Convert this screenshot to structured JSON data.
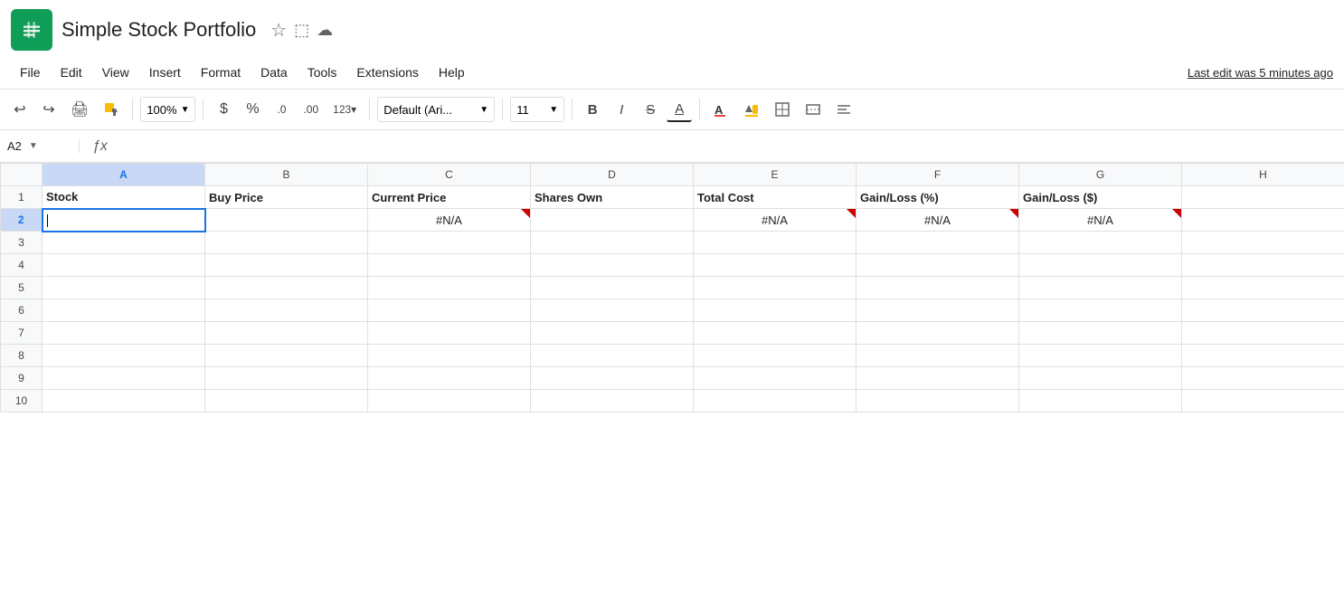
{
  "app": {
    "icon_color": "#0F9D58",
    "title": "Simple Stock Portfolio",
    "icons": [
      "☆",
      "⬚",
      "☁"
    ]
  },
  "menu": {
    "items": [
      "File",
      "Edit",
      "View",
      "Insert",
      "Format",
      "Data",
      "Tools",
      "Extensions",
      "Help"
    ],
    "last_edit": "Last edit was 5 minutes ago"
  },
  "toolbar": {
    "zoom": "100%",
    "currency": "$",
    "percent": "%",
    "decimal_less": ".0",
    "decimal_more": ".00",
    "format_number": "123",
    "font": "Default (Ari...",
    "font_size": "11",
    "bold": "B",
    "italic": "I",
    "strikethrough": "S",
    "underline": "A"
  },
  "formula_bar": {
    "cell_ref": "A2",
    "formula_content": ""
  },
  "spreadsheet": {
    "col_headers": [
      "",
      "A",
      "B",
      "C",
      "D",
      "E",
      "F",
      "G",
      "H"
    ],
    "row_count": 10,
    "headers_row": {
      "stock": "Stock",
      "buy_price": "Buy Price",
      "current_price": "Current Price",
      "shares_own": "Shares Own",
      "total_cost": "Total Cost",
      "gain_loss_pct": "Gain/Loss (%)",
      "gain_loss_dollar": "Gain/Loss ($)"
    },
    "data_rows": [
      {
        "row": 2,
        "a": "",
        "b": "",
        "c": "#N/A",
        "d": "",
        "e": "#N/A",
        "f": "#N/A",
        "g": "#N/A",
        "selected_a": true
      },
      {
        "row": 3,
        "a": "",
        "b": "",
        "c": "",
        "d": "",
        "e": "",
        "f": "",
        "g": ""
      },
      {
        "row": 4,
        "a": "",
        "b": "",
        "c": "",
        "d": "",
        "e": "",
        "f": "",
        "g": ""
      },
      {
        "row": 5,
        "a": "",
        "b": "",
        "c": "",
        "d": "",
        "e": "",
        "f": "",
        "g": ""
      },
      {
        "row": 6,
        "a": "",
        "b": "",
        "c": "",
        "d": "",
        "e": "",
        "f": "",
        "g": ""
      },
      {
        "row": 7,
        "a": "",
        "b": "",
        "c": "",
        "d": "",
        "e": "",
        "f": "",
        "g": ""
      },
      {
        "row": 8,
        "a": "",
        "b": "",
        "c": "",
        "d": "",
        "e": "",
        "f": "",
        "g": ""
      },
      {
        "row": 9,
        "a": "",
        "b": "",
        "c": "",
        "d": "",
        "e": "",
        "f": "",
        "g": ""
      },
      {
        "row": 10,
        "a": "",
        "b": "",
        "c": "",
        "d": "",
        "e": "",
        "f": "",
        "g": ""
      }
    ]
  }
}
